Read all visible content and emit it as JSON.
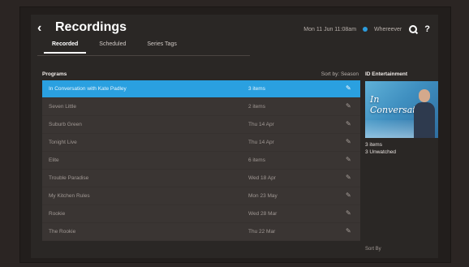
{
  "header": {
    "title": "Recordings",
    "datetime": "Mon 11 Jun 11:08am",
    "location": "Whereever"
  },
  "tabs": [
    {
      "label": "Recorded",
      "active": true
    },
    {
      "label": "Scheduled",
      "active": false
    },
    {
      "label": "Series Tags",
      "active": false
    }
  ],
  "list": {
    "column_title": "Programs",
    "sort_label": "Sort by: Season",
    "rows": [
      {
        "name": "In Conversation with Kate Padley",
        "date": "3 items",
        "selected": true
      },
      {
        "name": "Seven Little",
        "date": "2 items",
        "selected": false
      },
      {
        "name": "Suburb Green",
        "date": "Thu 14 Apr",
        "selected": false
      },
      {
        "name": "Tonight Live",
        "date": "Thu 14 Apr",
        "selected": false
      },
      {
        "name": "Elite",
        "date": "6 items",
        "selected": false
      },
      {
        "name": "Trouble Paradise",
        "date": "Wed 18 Apr",
        "selected": false
      },
      {
        "name": "My Kitchen Rules",
        "date": "Mon 23 May",
        "selected": false
      },
      {
        "name": "Rookie",
        "date": "Wed 28 Mar",
        "selected": false
      },
      {
        "name": "The Rookie",
        "date": "Thu 22 Mar",
        "selected": false
      }
    ]
  },
  "panel": {
    "title": "ID Entertainment",
    "thumbnail_text": "In Conversation",
    "items": "3 items",
    "unwatched": "3 Unwatched",
    "footer": "Sort By"
  },
  "colors": {
    "accent": "#2aa0e0",
    "background": "#2a2725"
  }
}
